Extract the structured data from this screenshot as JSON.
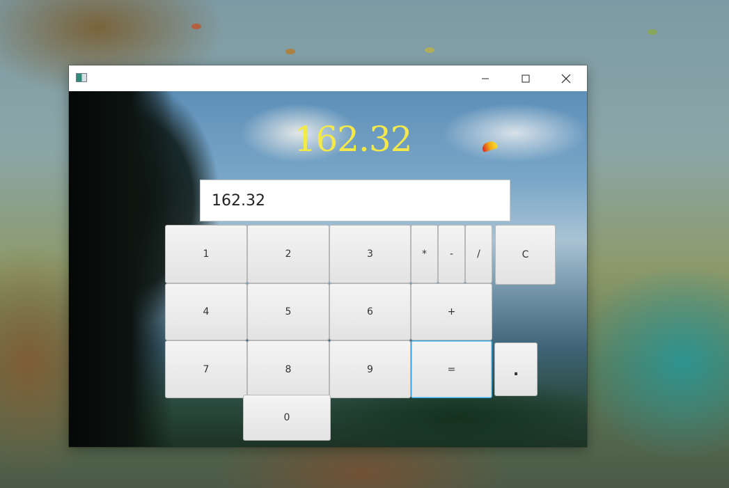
{
  "window": {
    "title": ""
  },
  "display": {
    "result": "162.32",
    "input_value": "162.32"
  },
  "keys": {
    "k1": "1",
    "k2": "2",
    "k3": "3",
    "k4": "4",
    "k5": "5",
    "k6": "6",
    "k7": "7",
    "k8": "8",
    "k9": "9",
    "k0": "0",
    "multiply": "*",
    "minus": "-",
    "divide": "/",
    "clear": "C",
    "plus": "+",
    "equals": "=",
    "dot": "."
  },
  "colors": {
    "result_text": "#f4e84a",
    "focus_border": "#3aa0d8"
  }
}
